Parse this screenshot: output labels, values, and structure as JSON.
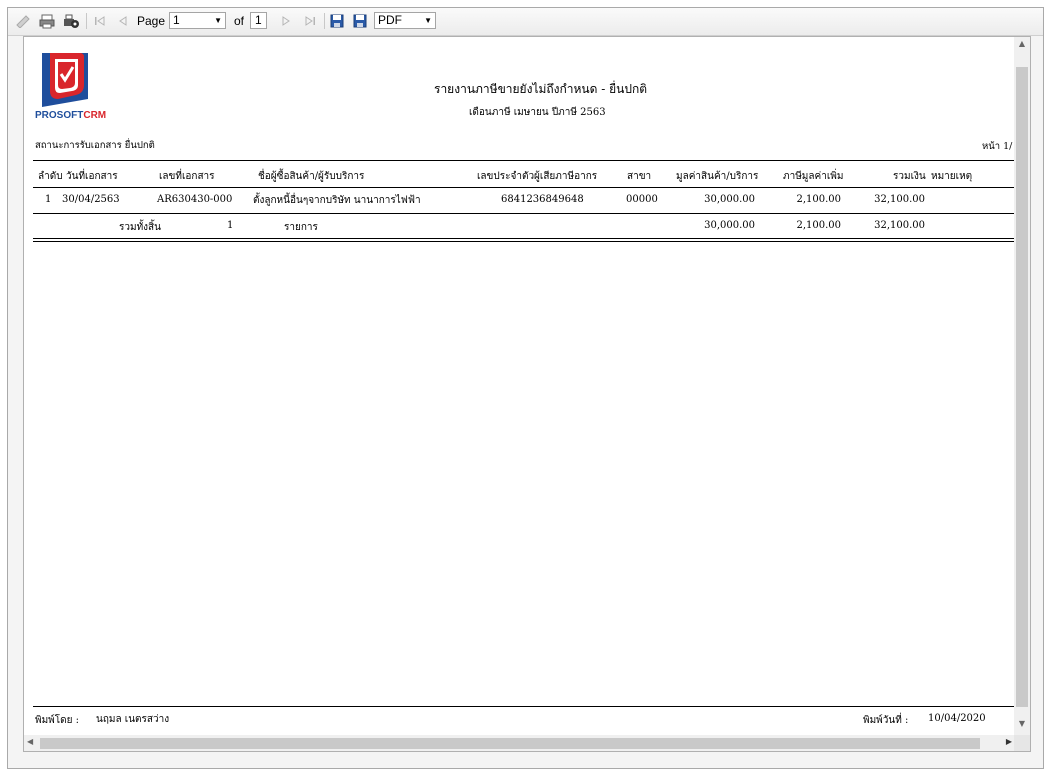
{
  "toolbar": {
    "page_label": "Page",
    "page_value": "1",
    "of_label": "of",
    "total_pages": "1",
    "export_format": "PDF"
  },
  "report": {
    "brand_part1": "PROSOFT",
    "brand_part2": "CRM",
    "title": "รายงานภาษีขายยังไม่ถึงกำหนด - ยื่นปกติ",
    "subtitle": "เดือนภาษี เมษายน ปีภาษี 2563",
    "status_label": "สถานะการรับเอกสาร ยื่นปกติ",
    "page_indicator": "หน้า 1/",
    "columns": {
      "no": "ลำดับ",
      "date": "วันที่เอกสาร",
      "doc_no": "เลขที่เอกสาร",
      "customer": "ชื่อผู้ซื้อสินค้า/ผู้รับบริการ",
      "tax_id": "เลขประจำตัวผู้เสียภาษีอากร",
      "branch": "สาขา",
      "amount": "มูลค่าสินค้า/บริการ",
      "vat": "ภาษีมูลค่าเพิ่ม",
      "total": "รวมเงิน",
      "note": "หมายเหตุ"
    },
    "rows": [
      {
        "no": "1",
        "date": "30/04/2563",
        "doc_no": "AR630430-000",
        "customer": "ตั้งลูกหนี้อื่นๆจากบริษัท นานาการไฟฟ้า",
        "tax_id": "6841236849648",
        "branch": "00000",
        "amount": "30,000.00",
        "vat": "2,100.00",
        "total": "32,100.00"
      }
    ],
    "summary": {
      "label": "รวมทั้งสิ้น",
      "count": "1",
      "unit": "รายการ",
      "amount": "30,000.00",
      "vat": "2,100.00",
      "total": "32,100.00"
    },
    "footer": {
      "printed_by_label": "พิมพ์โดย :",
      "printed_by": "นฤมล เนตรสว่าง",
      "printed_date_label": "พิมพ์วันที่ :",
      "printed_date": "10/04/2020"
    }
  },
  "colors": {
    "logo_red": "#d9262c",
    "logo_blue": "#1f4e9c"
  }
}
